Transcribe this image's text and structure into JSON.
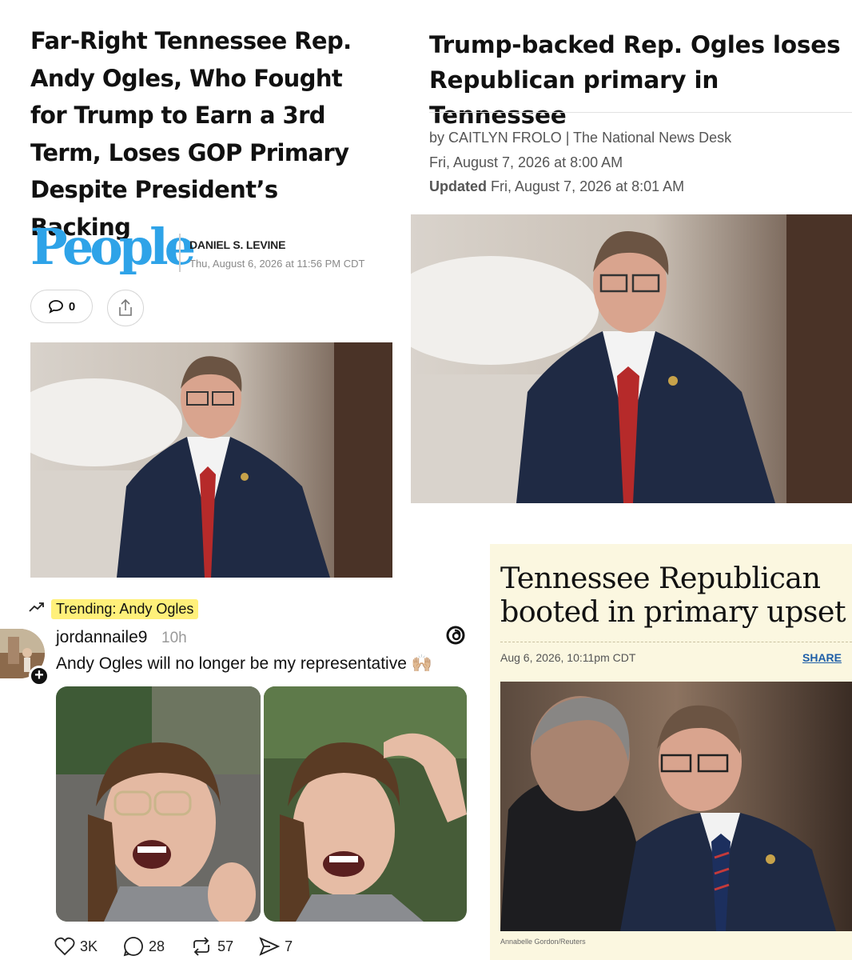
{
  "people": {
    "headline": "Far-Right Tennessee Rep. Andy Ogles, Who Fought for Trump to Earn a 3rd Term, Loses GOP Primary Despite President’s Backing",
    "logo": "People",
    "author": "DANIEL S. LEVINE",
    "date": "Thu, August 6, 2026 at 11:56 PM CDT",
    "comment_count": "0",
    "icons": [
      "comment-icon",
      "share-icon"
    ]
  },
  "nnd": {
    "headline": "Trump-backed Rep. Ogles loses Republican primary in Tennessee",
    "byline": "by CAITLYN FROLO | The National News Desk",
    "published": "Fri, August 7, 2026 at 8:00 AM",
    "updated_label": "Updated",
    "updated": "Fri, August 7, 2026 at 8:01 AM"
  },
  "threads": {
    "trending_label": "Trending: Andy Ogles",
    "username": "jordannaile9",
    "time": "10h",
    "text": "Andy Ogles will no longer be my representative 🙌🏼",
    "likes": "3K",
    "replies": "28",
    "reposts": "57",
    "shares": "7",
    "icons": [
      "trending-icon",
      "threads-logo-icon",
      "heart-icon",
      "reply-icon",
      "repost-icon",
      "send-icon"
    ]
  },
  "economist": {
    "headline": "Tennessee Republican booted in primary upset",
    "date": "Aug 6, 2026, 10:11pm CDT",
    "share_label": "SHARE",
    "caption": "Annabelle Gordon/Reuters"
  },
  "colors": {
    "people_blue": "#2ea3e8",
    "trend_highlight": "#fff07a",
    "economist_bg": "#fbf7e0",
    "link_blue": "#1f5fa8"
  }
}
